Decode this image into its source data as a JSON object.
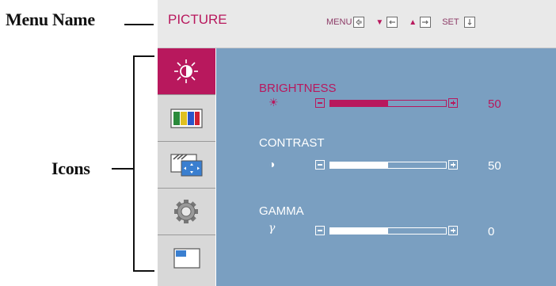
{
  "callouts": {
    "menu_name": "Menu Name",
    "icons": "Icons"
  },
  "menubar": {
    "menu_name": "PICTURE",
    "controls": {
      "menu_label": "MENU",
      "set_label": "SET"
    }
  },
  "icons": [
    "brightness-icon",
    "color-bars-icon",
    "screen-position-icon",
    "setup-gear-icon",
    "window-icon"
  ],
  "items": [
    {
      "title": "BRIGHTNESS",
      "symbol": "☀",
      "value": "50",
      "level": 0.5,
      "active": true
    },
    {
      "title": "CONTRAST",
      "symbol": "◑",
      "value": "50",
      "level": 0.5,
      "active": false
    },
    {
      "title": "GAMMA",
      "symbol": "γ",
      "value": "0",
      "level": 0.5,
      "active": false
    }
  ],
  "colors": {
    "accent": "#b8185d",
    "panel": "#7a9fc1",
    "menubar": "#e9e9e9",
    "sidebar": "#d8d8d8"
  }
}
